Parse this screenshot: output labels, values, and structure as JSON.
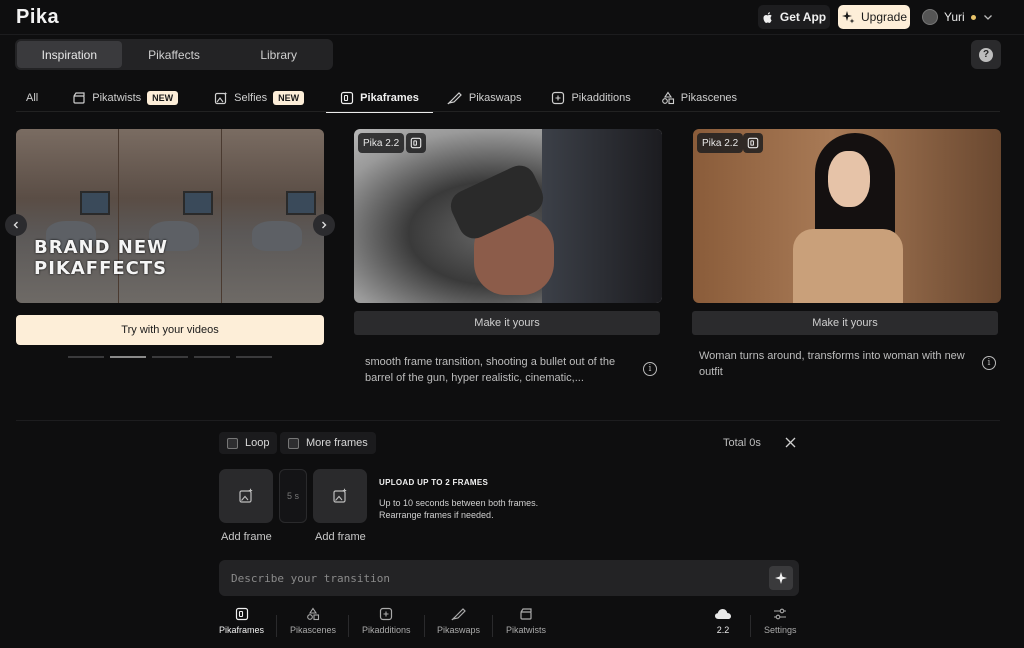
{
  "header": {
    "logo": "Pika",
    "get_app": "Get App",
    "upgrade": "Upgrade",
    "user_name": "Yuri"
  },
  "view_tabs": [
    "Inspiration",
    "Pikaffects",
    "Library"
  ],
  "active_view": "Inspiration",
  "tabs": [
    {
      "label": "All",
      "icon": "",
      "badge": ""
    },
    {
      "label": "Pikatwists",
      "icon": "clapper-icon",
      "badge": "NEW"
    },
    {
      "label": "Selfies",
      "icon": "image-sparkle-icon",
      "badge": "NEW"
    },
    {
      "label": "Pikaframes",
      "icon": "frames-icon",
      "badge": ""
    },
    {
      "label": "Pikaswaps",
      "icon": "brush-icon",
      "badge": ""
    },
    {
      "label": "Pikadditions",
      "icon": "add-frame-icon",
      "badge": ""
    },
    {
      "label": "Pikascenes",
      "icon": "shapes-icon",
      "badge": ""
    }
  ],
  "active_tab": "Pikaframes",
  "hero": {
    "title_line1": "BRAND NEW",
    "title_line2": "PIKAFFECTS",
    "cta": "Try with your videos",
    "carousel_pages": 5,
    "carousel_active": 1
  },
  "cards": [
    {
      "model": "Pika 2.2",
      "cta": "Make it yours",
      "description": "smooth frame transition, shooting a bullet out of the barrel of the gun, hyper realistic, cinematic,..."
    },
    {
      "model": "Pika 2.2",
      "cta": "Make it yours",
      "description": "Woman turns around, transforms into woman with new outfit"
    }
  ],
  "composer": {
    "loop_label": "Loop",
    "more_frames_label": "More frames",
    "total_label": "Total 0s",
    "frame_label": "Add frame",
    "gap_label": "5 s",
    "upload_title": "UPLOAD UP TO 2 FRAMES",
    "upload_line1": "Up to 10 seconds between both frames.",
    "upload_line2": "Rearrange frames if needed.",
    "prompt_placeholder": "Describe your transition"
  },
  "bottom_nav": [
    "Pikaframes",
    "Pikascenes",
    "Pikadditions",
    "Pikaswaps",
    "Pikatwists"
  ],
  "bottom_active": "Pikaframes",
  "model_version": "2.2",
  "settings_label": "Settings",
  "colors": {
    "background": "#0e0e0f",
    "accent_cream": "#fdeed8",
    "user_status_dot": "#e9c46a"
  }
}
